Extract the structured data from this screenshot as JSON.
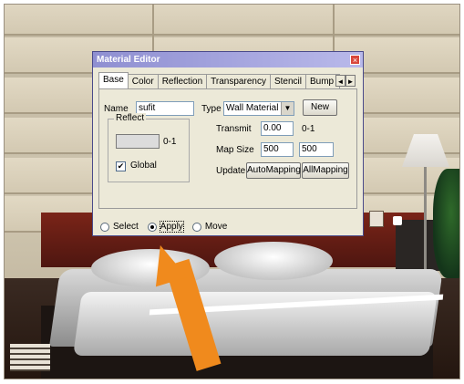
{
  "dialog": {
    "title": "Material Editor",
    "close_glyph": "×",
    "tabs": [
      "Base",
      "Color",
      "Reflection",
      "Transparency",
      "Stencil",
      "Bump"
    ],
    "active_tab": "Base",
    "tab_scroll_left": "◄",
    "tab_scroll_right": "►",
    "name_label": "Name",
    "name_value": "sufit",
    "type_label": "Type",
    "type_value": "Wall Material",
    "new_button": "New",
    "reflect_label": "Reflect",
    "reflect_range": "0-1",
    "global_label": "Global",
    "global_checked": true,
    "transmit_label": "Transmit",
    "transmit_value": "0.00",
    "transmit_range": "0-1",
    "map_size_label": "Map Size",
    "map_size_w": "500",
    "map_size_h": "500",
    "update_label": "Update:",
    "auto_mapping_button": "AutoMapping",
    "all_mapping_button": "AllMapping",
    "modes": [
      "Select",
      "Apply",
      "Move"
    ],
    "selected_mode": "Apply"
  },
  "colors": {
    "title_bar": "#8f8fd1",
    "dialog_bg": "#ece9d8",
    "arrow": "#f08a1d"
  },
  "icons": {
    "close": "close-icon",
    "dropdown": "chevron-down-icon",
    "scroll_left": "arrow-left-icon",
    "scroll_right": "arrow-right-icon",
    "arrow": "pointer-arrow-icon"
  }
}
